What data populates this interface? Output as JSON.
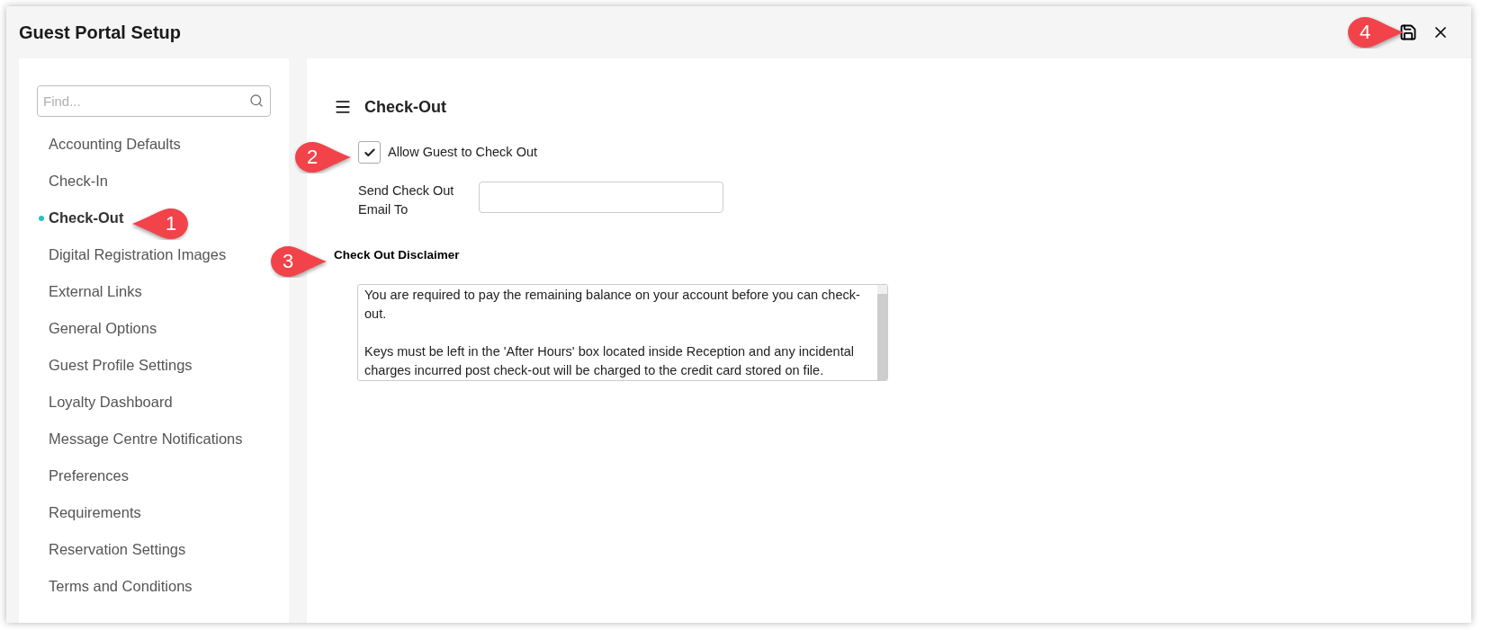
{
  "window": {
    "title": "Guest Portal Setup"
  },
  "sidebar": {
    "search": {
      "placeholder": "Find..."
    },
    "items": [
      {
        "label": "Accounting Defaults",
        "selected": false
      },
      {
        "label": "Check-In",
        "selected": false
      },
      {
        "label": "Check-Out",
        "selected": true
      },
      {
        "label": "Digital Registration Images",
        "selected": false
      },
      {
        "label": "External Links",
        "selected": false
      },
      {
        "label": "General Options",
        "selected": false
      },
      {
        "label": "Guest Profile Settings",
        "selected": false
      },
      {
        "label": "Loyalty Dashboard",
        "selected": false
      },
      {
        "label": "Message Centre Notifications",
        "selected": false
      },
      {
        "label": "Preferences",
        "selected": false
      },
      {
        "label": "Requirements",
        "selected": false
      },
      {
        "label": "Reservation Settings",
        "selected": false
      },
      {
        "label": "Terms and Conditions",
        "selected": false
      }
    ]
  },
  "main": {
    "heading": "Check-Out",
    "allow_checkout": {
      "label": "Allow Guest to Check Out",
      "checked": true
    },
    "email_field": {
      "label": "Send Check Out Email To"
    },
    "disclaimer": {
      "label": "Check Out Disclaimer",
      "paragraphs": [
        "You are required to pay the remaining balance on your account before you can check-out.",
        "Keys must be left in the 'After Hours' box located inside Reception and any incidental charges incurred post check-out will be charged to the credit card stored on file."
      ]
    }
  },
  "callouts": [
    {
      "number": "1",
      "kind": "sidebar"
    },
    {
      "number": "2",
      "kind": "checkbox"
    },
    {
      "number": "3",
      "kind": "disclaimer"
    },
    {
      "number": "4",
      "kind": "save"
    }
  ]
}
